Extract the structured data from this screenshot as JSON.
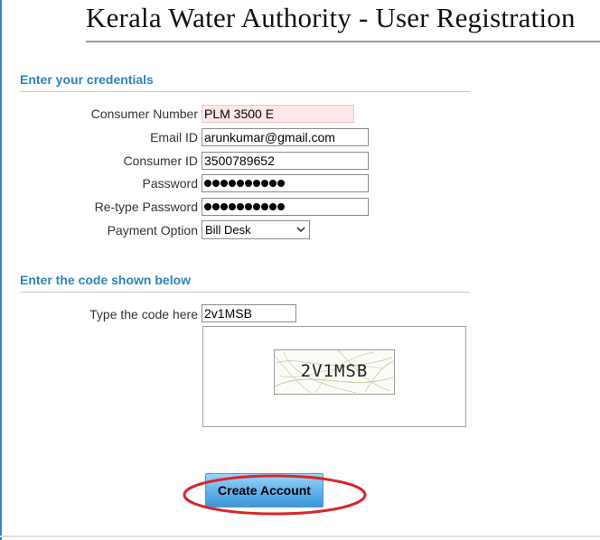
{
  "page": {
    "title": "Kerala Water Authority - User Registration"
  },
  "credentials": {
    "heading": "Enter your credentials",
    "consumer_number": {
      "label": "Consumer Number",
      "value": "PLM 3500 E"
    },
    "email": {
      "label": "Email ID",
      "value": "arunkumar@gmail.com"
    },
    "consumer_id": {
      "label": "Consumer ID",
      "value": "3500789652"
    },
    "password": {
      "label": "Password",
      "masked_length": 10
    },
    "retype_password": {
      "label": "Re-type Password",
      "masked_length": 10
    },
    "payment_option": {
      "label": "Payment Option",
      "selected": "Bill Desk"
    }
  },
  "captcha": {
    "heading": "Enter the code shown below",
    "label": "Type the code here",
    "value": "2v1MSB",
    "image_text": "2V1MSB"
  },
  "actions": {
    "create_account": "Create Account"
  },
  "colors": {
    "heading": "#2f82b8",
    "highlight_ellipse": "#d9252a",
    "button_top": "#9fd3f7",
    "button_bottom": "#3d97d9",
    "consumer_number_bg": "#fde7e7"
  },
  "icons": {
    "select_arrow": "chevron-down-icon"
  }
}
